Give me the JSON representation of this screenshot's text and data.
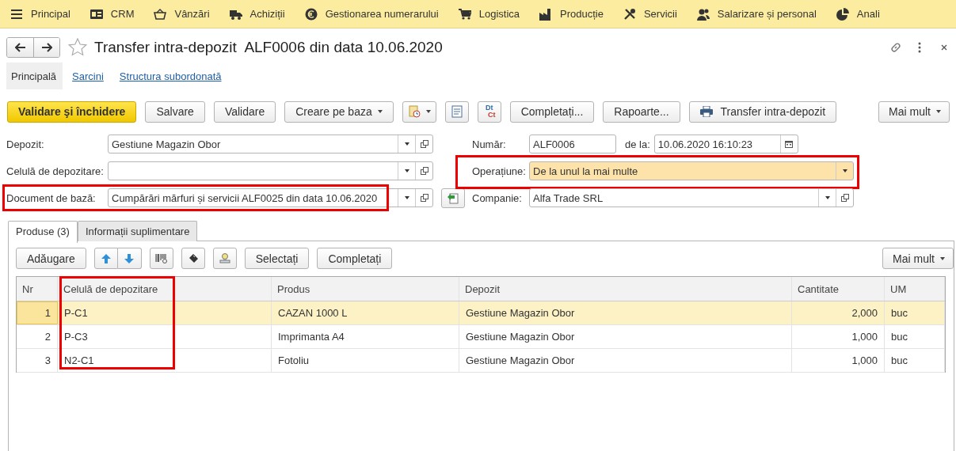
{
  "menu": [
    {
      "label": "Principal"
    },
    {
      "label": "CRM"
    },
    {
      "label": "Vânzări"
    },
    {
      "label": "Achiziții"
    },
    {
      "label": "Gestionarea numerarului"
    },
    {
      "label": "Logistica"
    },
    {
      "label": "Producție"
    },
    {
      "label": "Servicii"
    },
    {
      "label": "Salarizare și personal"
    },
    {
      "label": "Anali"
    }
  ],
  "title": "Transfer intra-depozit  ALF0006 din data 10.06.2020",
  "favorite": false,
  "sections": [
    {
      "label": "Principală",
      "selected": true
    },
    {
      "label": "Sarcini",
      "selected": false
    },
    {
      "label": "Structura subordonată",
      "selected": false
    }
  ],
  "toolbar": [
    {
      "kind": "primary",
      "label": "Validare şi închidere"
    },
    {
      "kind": "button",
      "label": "Salvare"
    },
    {
      "kind": "button",
      "label": "Validare"
    },
    {
      "kind": "dropdown",
      "label": "Creare pe baza"
    },
    {
      "kind": "docclock"
    },
    {
      "kind": "doc"
    },
    {
      "kind": "dtct",
      "lines": [
        "Dt",
        "Ct"
      ]
    },
    {
      "kind": "button",
      "label": "Completați..."
    },
    {
      "kind": "button",
      "label": "Rapoarte..."
    },
    {
      "kind": "print",
      "label": "Transfer intra-depozit"
    },
    {
      "kind": "more",
      "label": "Mai mult"
    }
  ],
  "fields_left": [
    {
      "label": "Depozit:",
      "value": "Gestiune Magazin Obor",
      "highlighted": false
    },
    {
      "label": "Celulă de depozitare:",
      "highlighted": false
    },
    {
      "label": "Document de bază:",
      "value": "Cumpărări mărfuri și servicii ALF0025 din data 10.06.2020",
      "highlighted": true
    }
  ],
  "number": {
    "label": "Număr:",
    "value": "ALF0006"
  },
  "date": {
    "label": "de la:",
    "value": "10.06.2020 16:10:23"
  },
  "operation": {
    "label": "Operațiune:",
    "value": "De la unul la mai multe",
    "highlighted": true
  },
  "company": {
    "label": "Companie:",
    "value": "Alfa Trade SRL"
  },
  "tabs": [
    {
      "label": "Produse (3)",
      "selected": true
    },
    {
      "label": "Informații suplimentare",
      "selected": false
    }
  ],
  "table_toolbar": [
    {
      "kind": "button",
      "label": "Adăugare"
    },
    {
      "kind": "updown"
    },
    {
      "kind": "barcode"
    },
    {
      "kind": "scanner"
    },
    {
      "kind": "stamp"
    },
    {
      "kind": "button",
      "label": "Selectați"
    },
    {
      "kind": "button",
      "label": "Completați"
    },
    {
      "kind": "more",
      "label": "Mai mult"
    }
  ],
  "table": {
    "columns": [
      {
        "label": "Nr",
        "highlighted": false
      },
      {
        "label": "Celulă de depozitare",
        "highlighted": true
      },
      {
        "label": "Produs",
        "highlighted": false
      },
      {
        "label": "Depozit",
        "highlighted": false
      },
      {
        "label": "Cantitate",
        "highlighted": false
      },
      {
        "label": "UM",
        "highlighted": false
      }
    ],
    "rows": [
      {
        "selected": true,
        "cells": [
          "1",
          "P-C1",
          "CAZAN 1000 L",
          "Gestiune Magazin Obor",
          "2,000",
          "buc"
        ]
      },
      {
        "selected": false,
        "cells": [
          "2",
          "P-C3",
          "Imprimanta A4",
          "Gestiune Magazin Obor",
          "1,000",
          "buc"
        ]
      },
      {
        "selected": false,
        "cells": [
          "3",
          "N2-C1",
          "Fotoliu",
          "Gestiune Magazin Obor",
          "1,000",
          "buc"
        ]
      }
    ]
  }
}
